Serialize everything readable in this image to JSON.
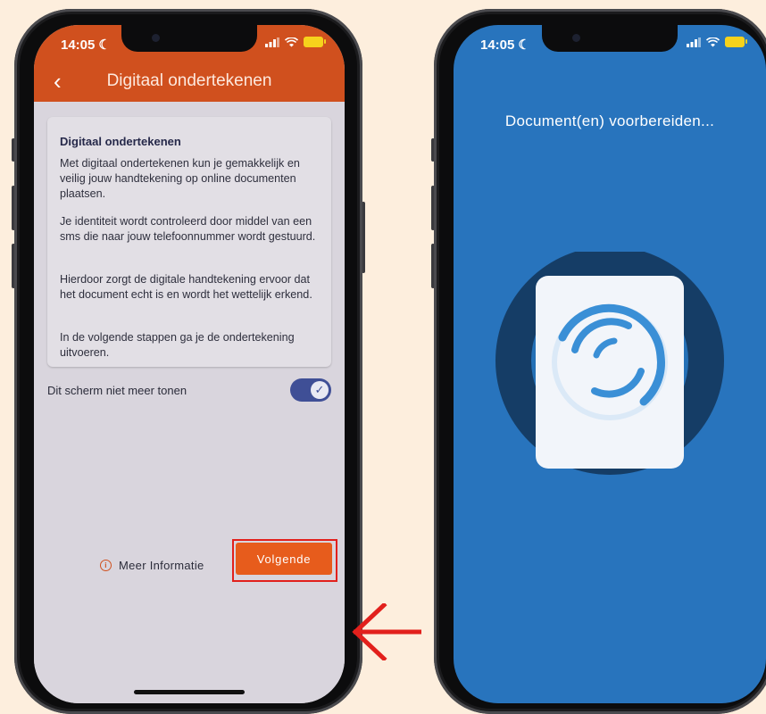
{
  "left_phone": {
    "status": {
      "time": "14:05"
    },
    "appbar": {
      "title": "Digitaal ondertekenen",
      "back_icon": "chevron-left-icon"
    },
    "card": {
      "heading": "Digitaal ondertekenen",
      "paragraphs": [
        "Met digitaal ondertekenen kun je gemakkelijk en veilig jouw handtekening op online documenten plaatsen.",
        "Je identiteit wordt controleerd door middel van een sms die naar jouw telefoonnummer wordt gestuurd.",
        "Hierdoor zorgt de digitale handtekening ervoor dat het document echt is en wordt het wettelijk erkend.",
        "In de volgende stappen ga je de ondertekening uitvoeren."
      ]
    },
    "toggle": {
      "label": "Dit scherm niet meer tonen",
      "checked": true
    },
    "footer": {
      "info_label": "Meer Informatie",
      "next_label": "Volgende"
    }
  },
  "right_phone": {
    "status": {
      "time": "14:05"
    },
    "message": "Document(en) voorbereiden..."
  },
  "colors": {
    "background": "#fdeedd",
    "appbar": "#d0501e",
    "next_button": "#e75c1c",
    "highlight_box": "#e2201c",
    "switch_on": "#3f4f96",
    "loading_screen": "#2874bd"
  }
}
